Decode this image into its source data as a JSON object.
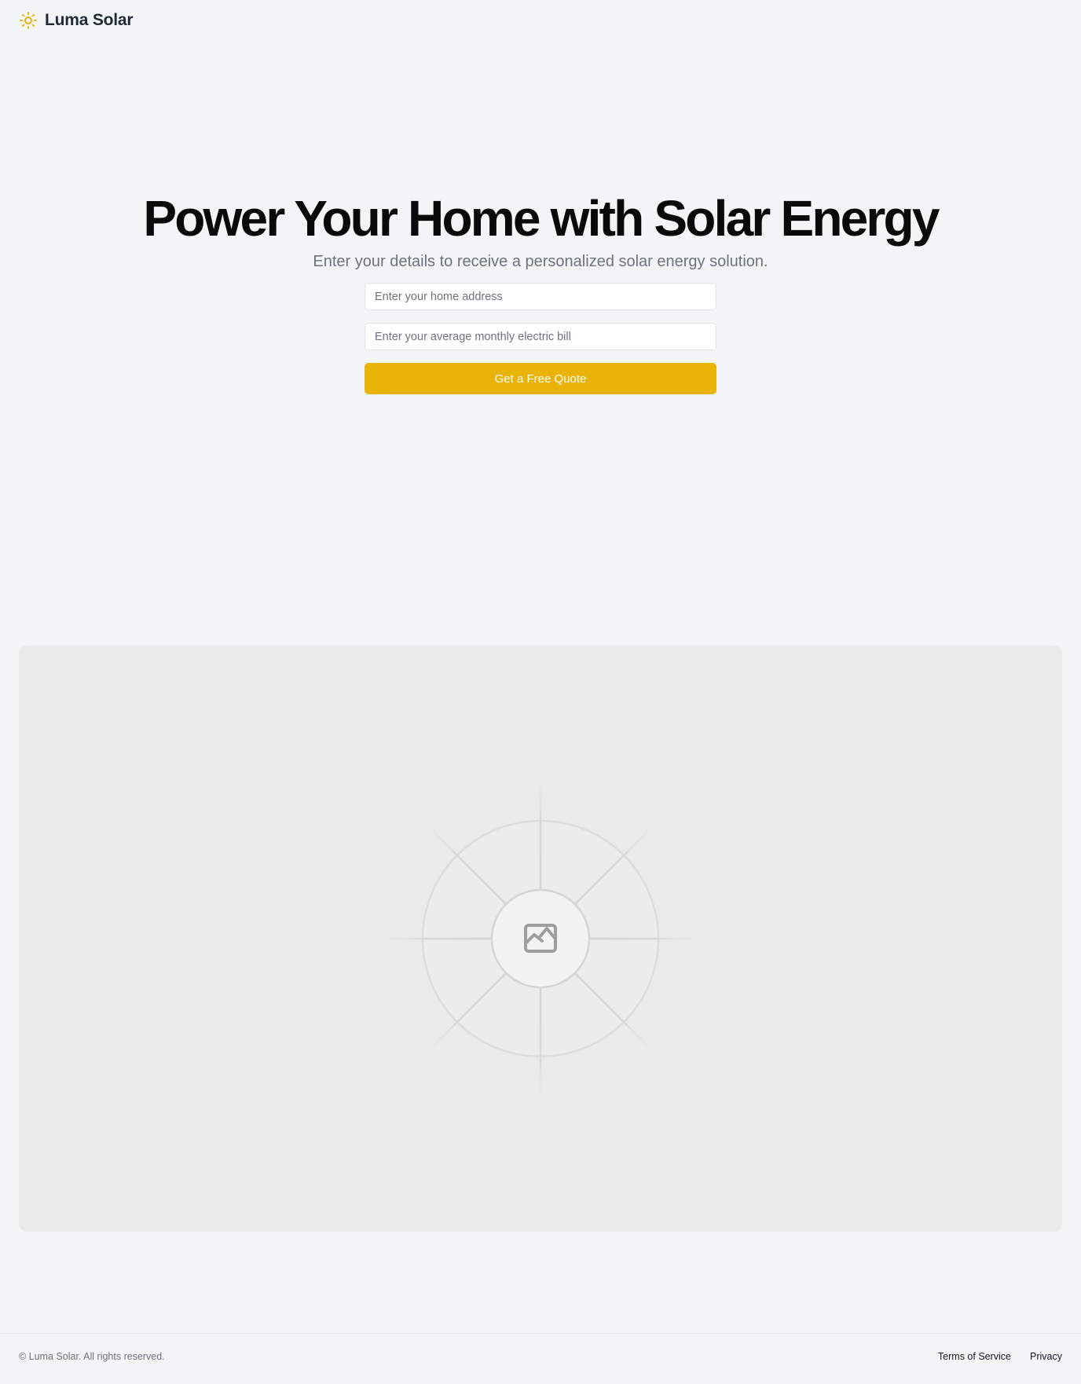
{
  "brand": {
    "name": "Luma Solar",
    "accent_color": "#eab308",
    "icon": "sun-icon"
  },
  "hero": {
    "title": "Power Your Home with Solar Energy",
    "subtitle": "Enter your details to receive a personalized solar energy solution."
  },
  "form": {
    "address": {
      "value": "",
      "placeholder": "Enter your home address"
    },
    "bill": {
      "value": "",
      "placeholder": "Enter your average monthly electric bill"
    },
    "submit_label": "Get a Free Quote"
  },
  "media": {
    "icon": "image-icon"
  },
  "footer": {
    "copyright": "© Luma Solar. All rights reserved.",
    "links": [
      {
        "label": "Terms of Service"
      },
      {
        "label": "Privacy"
      }
    ]
  }
}
